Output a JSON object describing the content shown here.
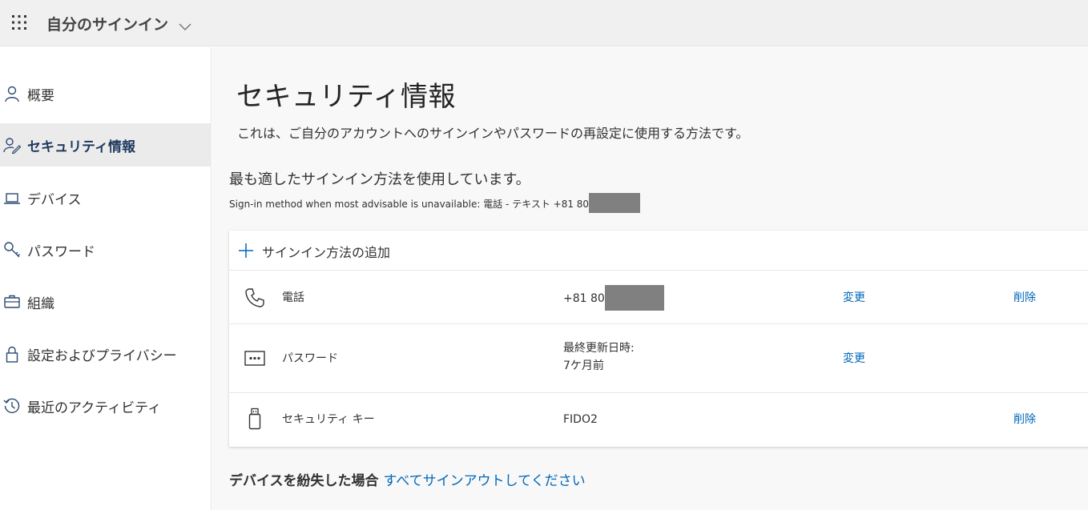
{
  "header": {
    "app_title": "自分のサインイン",
    "waffle_icon": "app-launcher-icon",
    "chevron_icon": "chevron-down-icon"
  },
  "sidebar": {
    "items": [
      {
        "label": "概要",
        "icon": "person-icon",
        "active": false
      },
      {
        "label": "セキュリティ情報",
        "icon": "person-edit-icon",
        "active": true
      },
      {
        "label": "デバイス",
        "icon": "laptop-icon",
        "active": false
      },
      {
        "label": "パスワード",
        "icon": "key-icon",
        "active": false
      },
      {
        "label": "組織",
        "icon": "briefcase-icon",
        "active": false
      },
      {
        "label": "設定およびプライバシー",
        "icon": "lock-icon",
        "active": false
      },
      {
        "label": "最近のアクティビティ",
        "icon": "history-icon",
        "active": false
      }
    ]
  },
  "main": {
    "title": "セキュリティ情報",
    "description": "これは、ご自分のアカウントへのサインインやパスワードの再設定に使用する方法です。",
    "default_heading": "最も適したサインイン方法を使用しています。",
    "fallback_text": "Sign-in method when most advisable is unavailable: 電話 - テキスト +81 80",
    "add_method_label": "サインイン方法の追加",
    "methods": [
      {
        "name": "電話",
        "icon": "phone-icon",
        "detail": "+81 80",
        "redacted": true,
        "change": "変更",
        "delete": "削除"
      },
      {
        "name": "パスワード",
        "icon": "password-dots-icon",
        "detail_line1": "最終更新日時:",
        "detail_line2": "7ケ月前",
        "change": "変更",
        "delete": ""
      },
      {
        "name": "セキュリティ キー",
        "icon": "usb-key-icon",
        "detail": "FIDO2",
        "change": "",
        "delete": "削除"
      }
    ],
    "lost_device_label": "デバイスを紛失した場合",
    "lost_device_link": "すべてサインアウトしてください"
  },
  "colors": {
    "link": "#0067b8",
    "topbar_bg": "#f0f0f0",
    "main_bg": "#f8f8f8",
    "active_nav_bg": "#ebebeb",
    "redaction": "#808080"
  }
}
